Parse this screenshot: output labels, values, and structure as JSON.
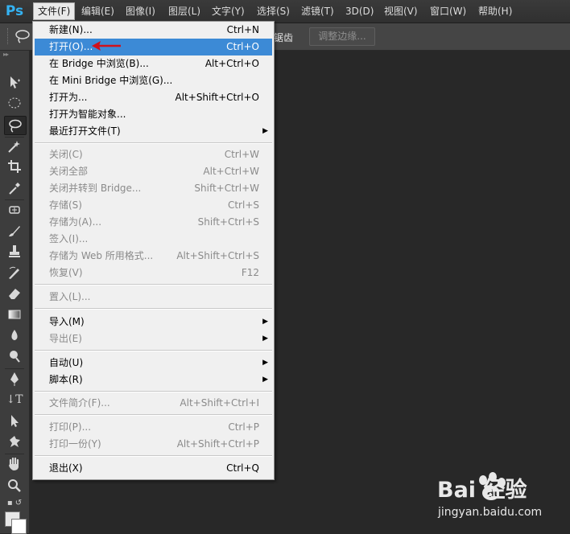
{
  "app": {
    "logo": "Ps"
  },
  "menubar": [
    {
      "label": "文件(F)",
      "active": true
    },
    {
      "label": "编辑(E)"
    },
    {
      "label": "图像(I)"
    },
    {
      "label": "图层(L)"
    },
    {
      "label": "文字(Y)"
    },
    {
      "label": "选择(S)"
    },
    {
      "label": "滤镜(T)"
    },
    {
      "label": "3D(D)"
    },
    {
      "label": "视图(V)"
    },
    {
      "label": "窗口(W)"
    },
    {
      "label": "帮助(H)"
    }
  ],
  "options": {
    "anti_alias_label": "锯齿",
    "refine_edge_label": "调整边缘..."
  },
  "file_menu": {
    "items": [
      {
        "label": "新建(N)...",
        "shortcut": "Ctrl+N"
      },
      {
        "label": "打开(O)...",
        "shortcut": "Ctrl+O",
        "highlight": true
      },
      {
        "label": "在 Bridge 中浏览(B)...",
        "shortcut": "Alt+Ctrl+O"
      },
      {
        "label": "在 Mini Bridge 中浏览(G)...",
        "shortcut": ""
      },
      {
        "label": "打开为...",
        "shortcut": "Alt+Shift+Ctrl+O"
      },
      {
        "label": "打开为智能对象...",
        "shortcut": ""
      },
      {
        "label": "最近打开文件(T)",
        "shortcut": "",
        "submenu": true
      },
      {
        "label": "关闭(C)",
        "shortcut": "Ctrl+W",
        "disabled": true
      },
      {
        "label": "关闭全部",
        "shortcut": "Alt+Ctrl+W",
        "disabled": true
      },
      {
        "label": "关闭并转到 Bridge...",
        "shortcut": "Shift+Ctrl+W",
        "disabled": true
      },
      {
        "label": "存储(S)",
        "shortcut": "Ctrl+S",
        "disabled": true
      },
      {
        "label": "存储为(A)...",
        "shortcut": "Shift+Ctrl+S",
        "disabled": true
      },
      {
        "label": "签入(I)...",
        "shortcut": "",
        "disabled": true
      },
      {
        "label": "存储为 Web 所用格式...",
        "shortcut": "Alt+Shift+Ctrl+S",
        "disabled": true
      },
      {
        "label": "恢复(V)",
        "shortcut": "F12",
        "disabled": true
      },
      {
        "label": "置入(L)...",
        "shortcut": "",
        "disabled": true
      },
      {
        "label": "导入(M)",
        "shortcut": "",
        "submenu": true
      },
      {
        "label": "导出(E)",
        "shortcut": "",
        "submenu": true,
        "disabled": true
      },
      {
        "label": "自动(U)",
        "shortcut": "",
        "submenu": true
      },
      {
        "label": "脚本(R)",
        "shortcut": "",
        "submenu": true
      },
      {
        "label": "文件简介(F)...",
        "shortcut": "Alt+Shift+Ctrl+I",
        "disabled": true
      },
      {
        "label": "打印(P)...",
        "shortcut": "Ctrl+P",
        "disabled": true
      },
      {
        "label": "打印一份(Y)",
        "shortcut": "Alt+Shift+Ctrl+P",
        "disabled": true
      },
      {
        "label": "退出(X)",
        "shortcut": "Ctrl+Q"
      }
    ]
  },
  "tools": [
    "move-tool",
    "marquee-tool",
    "lasso-tool",
    "magic-wand-tool",
    "crop-tool",
    "eyedropper-tool",
    "healing-brush-tool",
    "brush-tool",
    "clone-stamp-tool",
    "history-brush-tool",
    "eraser-tool",
    "gradient-tool",
    "blur-tool",
    "dodge-tool",
    "pen-tool",
    "type-tool",
    "path-selection-tool",
    "custom-shape-tool",
    "hand-tool",
    "zoom-tool"
  ],
  "watermark": {
    "brand": "Bai 经验",
    "url": "jingyan.baidu.com"
  },
  "colors": {
    "highlight": "#3c8ad6",
    "arrow": "#d0111b",
    "logo": "#34b2f2"
  }
}
